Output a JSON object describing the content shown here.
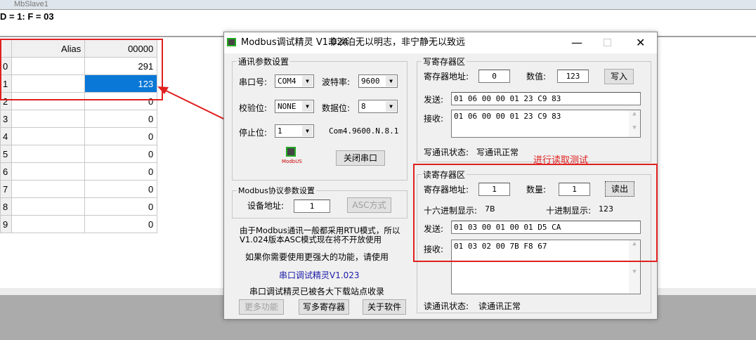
{
  "slave": {
    "title": "MbSlave1",
    "id_line": "D = 1: F = 03",
    "columns": [
      "Alias",
      "00000"
    ],
    "rows": [
      {
        "i": "0",
        "v": "291"
      },
      {
        "i": "1",
        "v": "123"
      },
      {
        "i": "2",
        "v": "0"
      },
      {
        "i": "3",
        "v": "0"
      },
      {
        "i": "4",
        "v": "0"
      },
      {
        "i": "5",
        "v": "0"
      },
      {
        "i": "6",
        "v": "0"
      },
      {
        "i": "7",
        "v": "0"
      },
      {
        "i": "8",
        "v": "0"
      },
      {
        "i": "9",
        "v": "0"
      }
    ]
  },
  "dialog": {
    "title": "Modbus调试精灵 V1.024",
    "motto": "非淡泊无以明志，非宁静无以致远",
    "logo_text": "ModbUS",
    "comm": {
      "legend": "通讯参数设置",
      "port_label": "串口号:",
      "port": "COM4",
      "baud_label": "波特率:",
      "baud": "9600",
      "parity_label": "校验位:",
      "parity": "NONE",
      "databits_label": "数据位:",
      "databits": "8",
      "stopbits_label": "停止位:",
      "stopbits": "1",
      "summary": "Com4.9600.N.8.1",
      "close_btn": "关闭串口"
    },
    "proto": {
      "legend": "Modbus协议参数设置",
      "addr_label": "设备地址:",
      "addr": "1",
      "asc_btn": "ASC方式"
    },
    "notes": {
      "line1": "由于Modbus通讯一般都采用RTU模式，所以",
      "line2": "V1.024版本ASC模式现在将不开放使用",
      "line3": "如果你需要使用更强大的功能，请使用",
      "link": "串口调试精灵V1.023",
      "line4": "串口调试精灵已被各大下载站点收录"
    },
    "buttons": {
      "more": "更多功能",
      "write_multi": "写多寄存器",
      "about": "关于软件"
    },
    "write": {
      "legend": "写寄存器区",
      "addr_label": "寄存器地址:",
      "addr": "0",
      "value_label": "数值:",
      "value": "123",
      "btn": "写入",
      "send_label": "发送:",
      "send": "01 06 00 00 01 23 C9 83",
      "recv_label": "接收:",
      "recv": "01 06 00 00 01 23 C9 83",
      "status_label": "写通讯状态:",
      "status": "写通讯正常"
    },
    "read": {
      "legend": "读寄存器区",
      "addr_label": "寄存器地址:",
      "addr": "1",
      "count_label": "数量:",
      "count": "1",
      "btn": "读出",
      "hex_label": "十六进制显示:",
      "hex": "7B",
      "dec_label": "十进制显示:",
      "dec": "123",
      "send_label": "发送:",
      "send": "01 03 00 01 00 01 D5 CA",
      "recv_label": "接收:",
      "recv": "01 03 02 00 7B F8 67",
      "status_label": "读通讯状态:",
      "status": "读通讯正常"
    }
  },
  "annotation": {
    "text": "进行读取测试",
    "color": "#e02020"
  }
}
